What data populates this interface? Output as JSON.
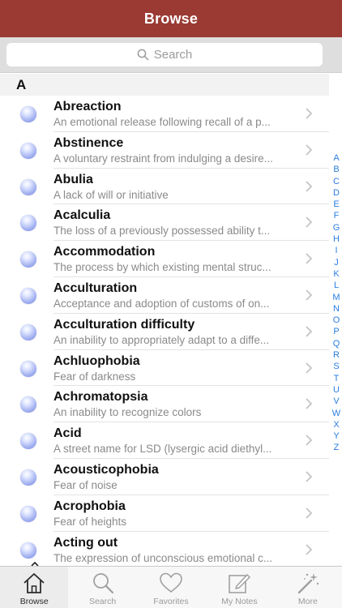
{
  "header": {
    "title": "Browse"
  },
  "search": {
    "placeholder": "Search"
  },
  "section": {
    "letter": "A"
  },
  "rows": [
    {
      "term": "Abreaction",
      "desc": "An emotional release following recall of a p..."
    },
    {
      "term": "Abstinence",
      "desc": "A voluntary restraint from indulging a desire..."
    },
    {
      "term": "Abulia",
      "desc": "A lack of will or initiative"
    },
    {
      "term": "Acalculia",
      "desc": "The loss of a previously possessed ability t..."
    },
    {
      "term": "Accommodation",
      "desc": "The process by which existing mental struc..."
    },
    {
      "term": "Acculturation",
      "desc": "Acceptance and adoption of customs of on..."
    },
    {
      "term": "Acculturation difficulty",
      "desc": "An inability to appropriately adapt to a diffe..."
    },
    {
      "term": "Achluophobia",
      "desc": "Fear of darkness"
    },
    {
      "term": "Achromatopsia",
      "desc": "An inability to recognize colors"
    },
    {
      "term": "Acid",
      "desc": "A street name for LSD (lysergic acid diethyl..."
    },
    {
      "term": "Acousticophobia",
      "desc": "Fear of noise"
    },
    {
      "term": "Acrophobia",
      "desc": "Fear of heights"
    },
    {
      "term": "Acting out",
      "desc": "The expression of unconscious emotional c..."
    }
  ],
  "index": [
    "A",
    "B",
    "C",
    "D",
    "E",
    "F",
    "G",
    "H",
    "I",
    "J",
    "K",
    "L",
    "M",
    "N",
    "O",
    "P",
    "Q",
    "R",
    "S",
    "T",
    "U",
    "V",
    "W",
    "X",
    "Y",
    "Z"
  ],
  "tabs": [
    {
      "label": "Browse",
      "icon": "home-icon"
    },
    {
      "label": "Search",
      "icon": "magnifier-icon"
    },
    {
      "label": "Favorites",
      "icon": "heart-icon"
    },
    {
      "label": "My Notes",
      "icon": "notepad-icon"
    },
    {
      "label": "More",
      "icon": "magic-wand-icon"
    }
  ],
  "colors": {
    "navbar": "#9a3a33",
    "index": "#2a7ee0",
    "bullet": "#9aa9ee"
  }
}
